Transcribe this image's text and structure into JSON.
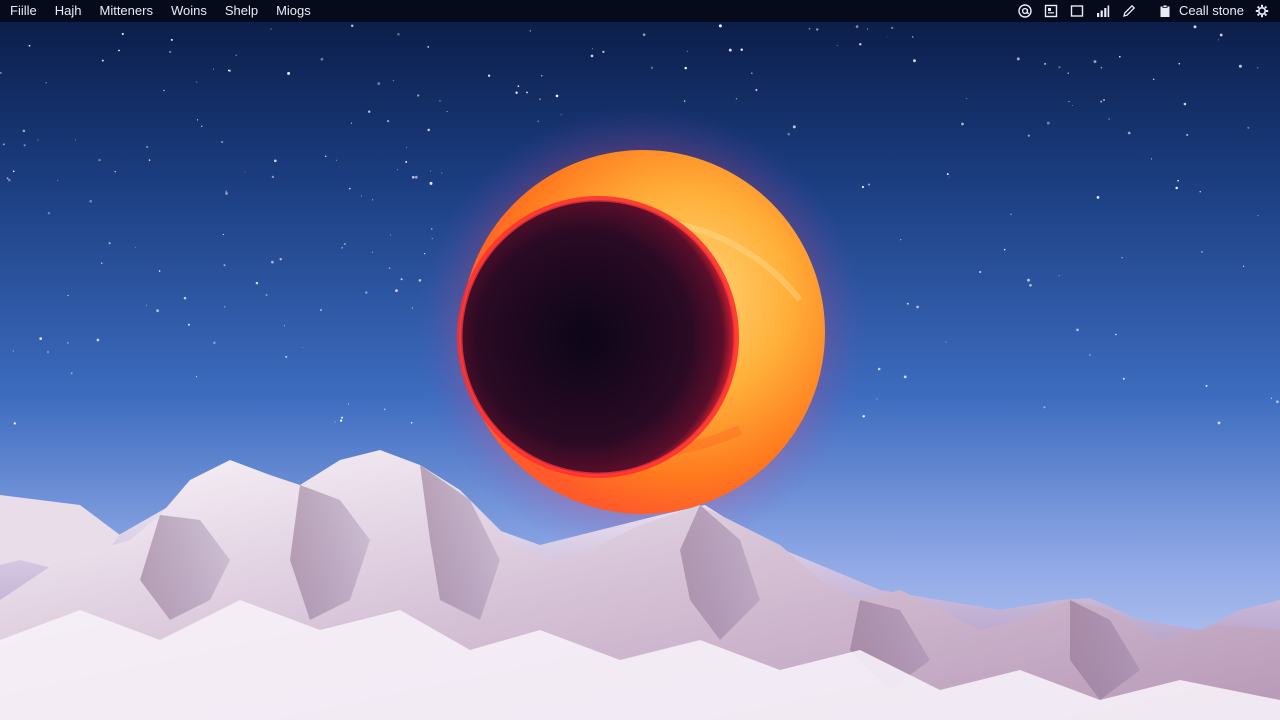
{
  "menubar": {
    "items": [
      {
        "label": "Fiille"
      },
      {
        "label": "Hajh"
      },
      {
        "label": "Mitteners"
      },
      {
        "label": "Woins"
      },
      {
        "label": "Shelp"
      },
      {
        "label": "Miogs"
      }
    ],
    "tray_icons": [
      "at-sign-icon",
      "calendar-icon",
      "window-icon",
      "signal-bars-icon",
      "pen-icon",
      "clipboard-icon",
      "gear-icon"
    ],
    "status_text": "Ceall stone"
  },
  "wallpaper": {
    "scene": "eclipse-over-mountains",
    "colors": {
      "sky_top": "#0c1d48",
      "sky_mid": "#3a6bbd",
      "sky_horizon": "#b9c8f2",
      "corona": "#ff8a1e",
      "moon": "#1a0720",
      "snow": "#f3ecf6",
      "rock": "#a07a9a"
    }
  }
}
